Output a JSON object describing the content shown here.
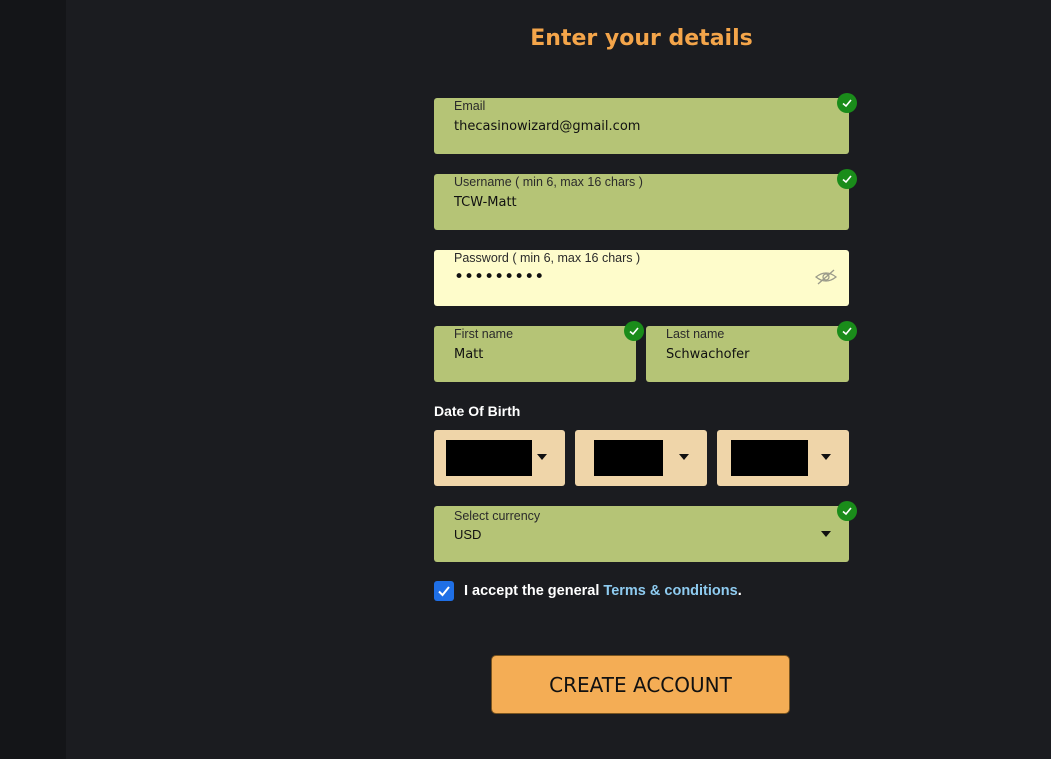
{
  "form": {
    "title": "Enter your details",
    "email": {
      "label": "Email",
      "value": "thecasinowizard@gmail.com",
      "valid": true
    },
    "username": {
      "label": "Username ( min 6, max 16 chars )",
      "value": "TCW-Matt",
      "valid": true
    },
    "password": {
      "label": "Password ( min 6, max 16 chars )",
      "value": "•••••••••"
    },
    "first_name": {
      "label": "First name",
      "value": "Matt",
      "valid": true
    },
    "last_name": {
      "label": "Last name",
      "value": "Schwachofer",
      "valid": true
    },
    "dob_label": "Date Of Birth",
    "currency": {
      "label": "Select currency",
      "value": "USD",
      "valid": true
    },
    "terms": {
      "prefix": "I accept the general ",
      "link": "Terms & conditions",
      "suffix": ".",
      "checked": true
    },
    "submit_label": "CREATE ACCOUNT"
  },
  "icons": {
    "valid": "check-icon",
    "toggle_password": "eye-slash-icon",
    "dropdown": "caret-down-icon"
  },
  "colors": {
    "accent": "#f4a54a",
    "valid_field": "#b5c476",
    "valid_badge": "#1a8c1a",
    "link": "#8ecbf0",
    "button": "#f4ad55"
  }
}
